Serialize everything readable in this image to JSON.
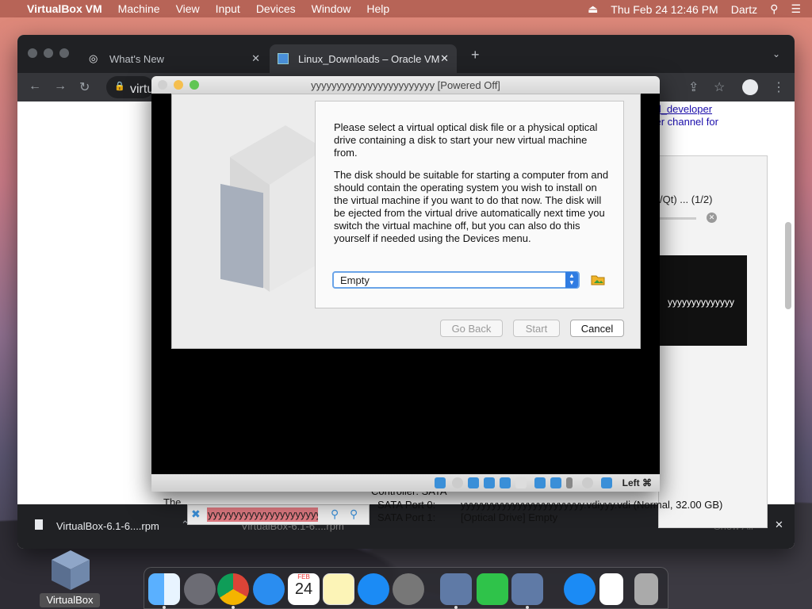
{
  "menubar": {
    "app": "VirtualBox VM",
    "items": [
      "Machine",
      "View",
      "Input",
      "Devices",
      "Window",
      "Help"
    ],
    "clock": "Thu Feb 24  12:46 PM",
    "user": "Dartz"
  },
  "chrome": {
    "tabs": [
      {
        "label": "What's New"
      },
      {
        "label": "Linux_Downloads – Oracle VM"
      }
    ],
    "omnibox_text": "virtu",
    "page_right_lines": [
      "oad_developer",
      "oper channel for"
    ],
    "download_label": "VirtualBox-6.1-6....rpm",
    "download_label_2": "VirtualBox-6.1-6....rpm",
    "download_show_all": "Show All"
  },
  "manager": {
    "progress_text": "/Qt) ... (1/2)",
    "preview_text": "yyyyyyyyyyyyyy"
  },
  "vm": {
    "title": "yyyyyyyyyyyyyyyyyyyyyyyy [Powered Off]",
    "status_key": "Left ⌘"
  },
  "dialog": {
    "paragraphs": [
      "Please select a virtual optical disk file or a physical optical drive containing a disk to start your new virtual machine from.",
      "The disk should be suitable for starting a computer from and should contain the operating system you wish to install on the virtual machine if you want to do that now. The disk will be ejected from the virtual drive automatically next time you switch the virtual machine off, but you can also do this yourself if needed using the Devices menu."
    ],
    "selected_disk": "Empty",
    "go_back": "Go Back",
    "start": "Start",
    "cancel": "Cancel"
  },
  "info": {
    "controller": "Controller: SATA",
    "port0_label": "SATA Port 0:",
    "port0_value": "yyyyyyyyyyyyyyyyyyyyyyyy.vdiyyy.vdi (Normal, 32.00 GB)",
    "port1_label": "SATA Port 1:",
    "port1_value": "[Optical Drive] Empty",
    "progress_name": "yyyyyyyyyyyyyyyyyyyyyyyy",
    "page_left_text": "The"
  },
  "dock": {
    "calendar_month": "FEB",
    "calendar_day": "24",
    "desktop_label": "VirtualBox"
  },
  "colors": {
    "accent": "#2f7ce2",
    "chrome_dark": "#202124",
    "progress_red": "#e07a82"
  }
}
